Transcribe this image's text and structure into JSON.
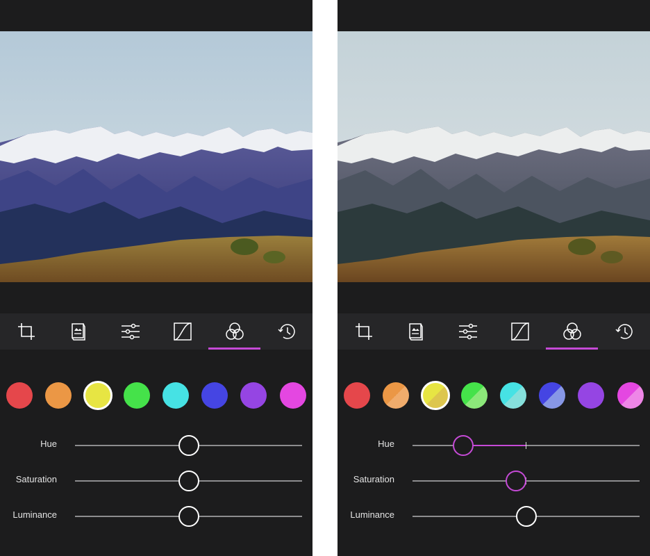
{
  "colors": {
    "background": "#1c1c1d",
    "toolbar": "#262628",
    "accent": "#c54ad6",
    "track": "#8d8d8f"
  },
  "toolbar": {
    "tools": [
      {
        "icon": "crop-icon"
      },
      {
        "icon": "layers-icon"
      },
      {
        "icon": "adjust-sliders-icon"
      },
      {
        "icon": "curves-icon"
      },
      {
        "icon": "hsl-color-icon"
      },
      {
        "icon": "history-icon"
      }
    ],
    "active_tool": "hsl-color-icon"
  },
  "swatches": [
    {
      "name": "red",
      "color": "#e5474b"
    },
    {
      "name": "orange",
      "color": "#eb9745"
    },
    {
      "name": "yellow",
      "color": "#e7e543"
    },
    {
      "name": "green",
      "color": "#45e24a"
    },
    {
      "name": "aqua",
      "color": "#46e2e4"
    },
    {
      "name": "blue",
      "color": "#4545e3"
    },
    {
      "name": "purple",
      "color": "#9545e3"
    },
    {
      "name": "magenta",
      "color": "#e447e1"
    }
  ],
  "panels": {
    "left": {
      "selected_swatch": "yellow",
      "edited_swatches": [],
      "sliders": {
        "hue": {
          "label": "Hue",
          "value": 0
        },
        "saturation": {
          "label": "Saturation",
          "value": 0
        },
        "luminance": {
          "label": "Luminance",
          "value": 0
        }
      }
    },
    "right": {
      "selected_swatch": "yellow",
      "edited_swatches": [
        "orange",
        "yellow",
        "green",
        "aqua",
        "blue",
        "magenta"
      ],
      "sliders": {
        "hue": {
          "label": "Hue",
          "value": -56
        },
        "saturation": {
          "label": "Saturation",
          "value": -9
        },
        "luminance": {
          "label": "Luminance",
          "value": 0
        }
      }
    }
  }
}
